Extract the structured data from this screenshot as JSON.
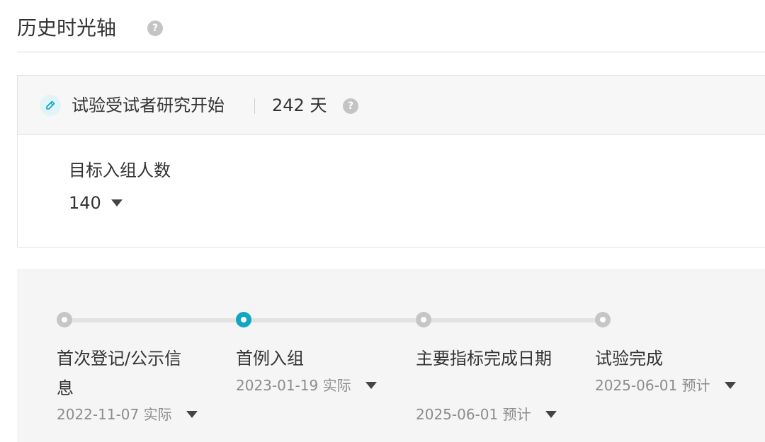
{
  "header": {
    "title": "历史时光轴",
    "help_icon": "question-mark-icon"
  },
  "study_card": {
    "icon": "pen-icon",
    "title": "试验受试者研究开始",
    "days": "242 天",
    "help_icon": "question-mark-icon",
    "target_label": "目标入组人数",
    "target_value": "140"
  },
  "colors": {
    "accent": "#10a6c4",
    "inactive_dot": "#c6c6c6",
    "muted_text": "#8c8c8c"
  },
  "timeline": [
    {
      "name": "首次登记/公示信息",
      "date": "2022-11-07 实际",
      "active": false
    },
    {
      "name": "首例入组",
      "date": "2023-01-19 实际",
      "active": true
    },
    {
      "name": "主要指标完成日期",
      "date": "2025-06-01 预计",
      "active": false
    },
    {
      "name": "试验完成",
      "date": "2025-06-01 预计",
      "active": false
    }
  ]
}
